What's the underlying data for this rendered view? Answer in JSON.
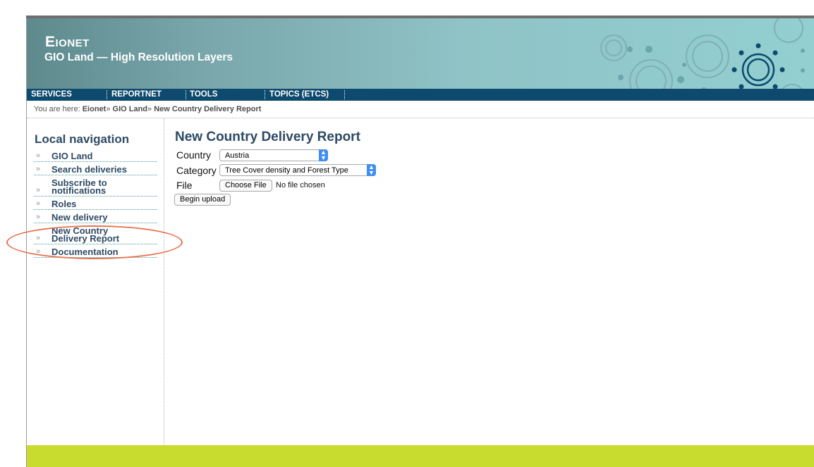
{
  "header": {
    "brand": "Eionet",
    "subtitle": "GIO Land — High Resolution Layers"
  },
  "topnav": [
    "SERVICES",
    "REPORTNET",
    "TOOLS",
    "TOPICS (ETCS)"
  ],
  "breadcrumb": {
    "prefix": "You are here:",
    "items": [
      "Eionet",
      "GIO Land",
      "New Country Delivery Report"
    ],
    "separator": "»"
  },
  "local_nav": {
    "title": "Local navigation",
    "items": [
      {
        "line1": "GIO Land",
        "line2": ""
      },
      {
        "line1": "Search deliveries",
        "line2": ""
      },
      {
        "line1": "Subscribe to",
        "line2": "notifications"
      },
      {
        "line1": "Roles",
        "line2": ""
      },
      {
        "line1": "New delivery",
        "line2": ""
      },
      {
        "line1": "New Country",
        "line2": "Delivery Report"
      },
      {
        "line1": "Documentation",
        "line2": ""
      }
    ],
    "bullet": "»"
  },
  "form": {
    "title": "New Country Delivery Report",
    "country_label": "Country",
    "country_value": "Austria",
    "category_label": "Category",
    "category_value": "Tree Cover density and Forest Type",
    "file_label": "File",
    "choose_file": "Choose File",
    "no_file": "No file chosen",
    "submit": "Begin upload"
  },
  "colors": {
    "nav_bg": "#0d4a6e",
    "heading": "#2e4a64",
    "footer": "#c8dc30",
    "highlight": "#e8724e"
  }
}
